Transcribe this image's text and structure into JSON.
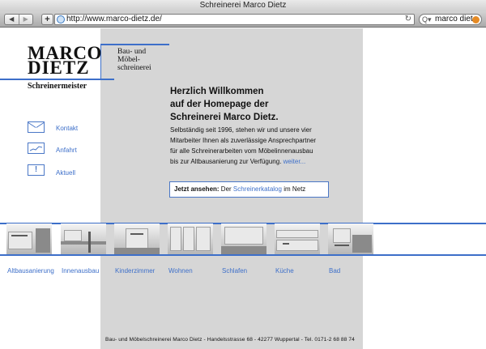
{
  "browser": {
    "window_title": "Schreinerei Marco Dietz",
    "back_symbol": "◀",
    "forward_symbol": "▶",
    "add_symbol": "+",
    "url": "http://www.marco-dietz.de/",
    "reload_symbol": "↻",
    "search_symbol": "Q▾",
    "search_query": "marco diet",
    "accent": "#e58a24"
  },
  "logo": {
    "line1": "MARCO",
    "line2": "DIETZ",
    "sub1": "Bau- und",
    "sub2": "Möbel-",
    "sub3": "schreinerei",
    "meister": "Schreinermeister",
    "brand_color": "#3d6fc9"
  },
  "sidenav": [
    {
      "label": "Kontakt",
      "icon": "mail-icon"
    },
    {
      "label": "Anfahrt",
      "icon": "map-icon"
    },
    {
      "label": "Aktuell",
      "icon": "exclamation-icon",
      "glyph": "!"
    }
  ],
  "welcome": {
    "heading1": "Herzlich Willkommen",
    "heading2": "auf der Homepage der",
    "heading3": "Schreinerei Marco Dietz.",
    "para1": "Selbständig seit 1996, stehen wir und unsere vier",
    "para2": "Mitarbeiter Ihnen als zuverlässige Ansprechpartner",
    "para3": "für alle Schreinerarbeiten vom Möbelinnenausbau",
    "para4": "bis zur Altbausanierung zur Verfügung.",
    "more": "weiter..."
  },
  "katalog": {
    "prefix": "Jetzt ansehen:",
    "before": " Der ",
    "link": "Schreinerkatalog",
    "after": " im Netz"
  },
  "categories": [
    "Altbausanierung",
    "Innenausbau",
    "Kinderzimmer",
    "Wohnen",
    "Schlafen",
    "Küche",
    "Bad"
  ],
  "footer": "Bau- und Möbelschreinerei Marco Dietz - Handelsstrasse 68 - 42277 Wuppertal - Tel. 0171-2 68 88 74"
}
